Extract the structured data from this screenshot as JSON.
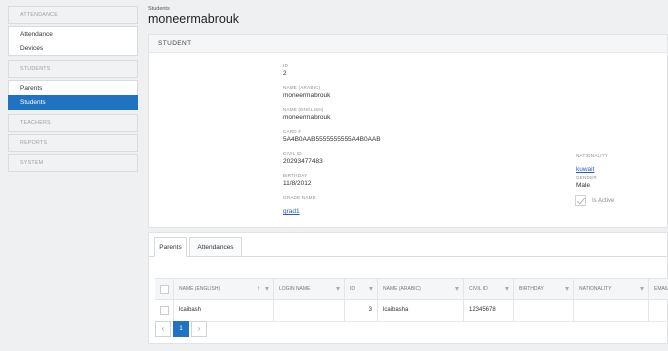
{
  "sidebar": {
    "attendance_section": "ATTENDANCE",
    "attendance_items": [
      "Attendance",
      "Devices"
    ],
    "students_section": "STUDENTS",
    "students_items": [
      "Parents",
      "Students"
    ],
    "teachers_section": "TEACHERS",
    "reports_section": "REPORTS",
    "system_section": "SYSTEM",
    "active_item": "Students",
    "accent_color": "#1f73c2"
  },
  "header": {
    "breadcrumb": "Students",
    "title": "moneermabrouk"
  },
  "student": {
    "card_title": "STUDENT",
    "id_label": "ID",
    "id_value": "2",
    "name_ar_label": "NAME (ARABIC)",
    "name_ar_value": "moneermabrouk",
    "name_en_label": "NAME (ENGLISH)",
    "name_en_value": "moneermabrouk",
    "card_label": "CARD #",
    "card_value": "5A4B0AAB5555555555A4B0AAB",
    "civil_label": "CIVIL ID",
    "civil_value": "20293477483",
    "birthday_label": "BIRTHDAY",
    "birthday_value": "11/8/2012",
    "grade_label": "GRADE NAME",
    "grade_value": "grad1",
    "nationality_label": "NATIONALITY",
    "nationality_value": "kuwait",
    "gender_label": "GENDER",
    "gender_value": "Male",
    "active_label": "Is Active"
  },
  "tabs": [
    "Parents",
    "Attendances"
  ],
  "grid": {
    "columns": [
      "NAME (ENGLISH)",
      "LOGIN NAME",
      "ID",
      "NAME (ARABIC)",
      "CIVIL ID",
      "BIRTHDAY",
      "NATIONALITY",
      "EMAIL"
    ],
    "sort_indicator": "↑",
    "rows": [
      {
        "name_en": "lcaibash",
        "login": "",
        "id": "3",
        "name_ar": "lcaibasha",
        "civil_id": "12345678",
        "birthday": "",
        "nationality": "",
        "email": ""
      }
    ]
  },
  "pager": {
    "prev": "‹",
    "page": "1",
    "next": "›"
  }
}
